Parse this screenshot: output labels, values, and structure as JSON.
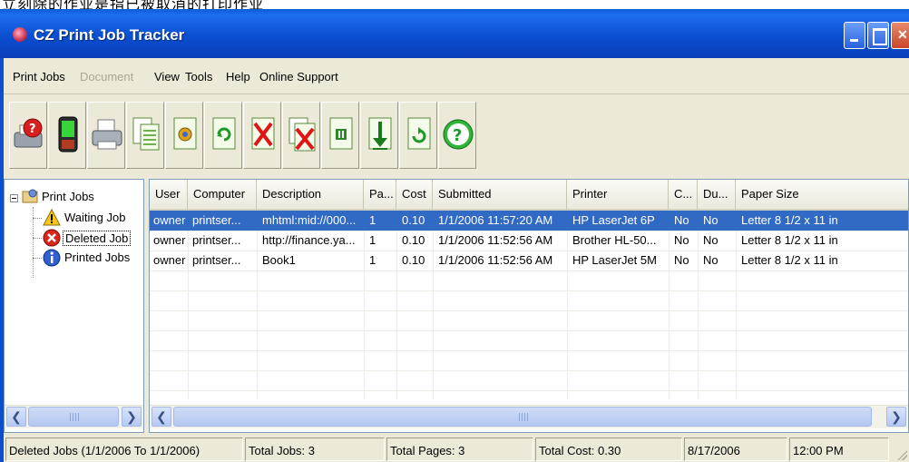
{
  "caption": "立刻除的作业是指已被取消的打印作业",
  "window": {
    "title": "CZ Print Job Tracker"
  },
  "menu": {
    "items": [
      "Print Jobs",
      "Document",
      "View",
      "Tools",
      "Help",
      "Online Support"
    ],
    "disabled": [
      "Document"
    ]
  },
  "toolbar": {
    "buttons": [
      {
        "name": "printer-help-icon"
      },
      {
        "name": "pda-icon"
      },
      {
        "name": "printer-icon"
      },
      {
        "name": "documents-icon"
      },
      {
        "name": "document-settings-icon"
      },
      {
        "name": "refresh-document-icon"
      },
      {
        "name": "delete-icon"
      },
      {
        "name": "delete-document-icon"
      },
      {
        "name": "pause-document-icon"
      },
      {
        "name": "move-down-icon"
      },
      {
        "name": "restart-document-icon"
      },
      {
        "name": "help-icon"
      }
    ]
  },
  "tree": {
    "root": "Print Jobs",
    "children": [
      "Waiting Job",
      "Deleted Job",
      "Printed Jobs"
    ],
    "selected": "Deleted Job"
  },
  "grid": {
    "columns": [
      "User",
      "Computer",
      "Description",
      "Pa...",
      "Cost",
      "Submitted",
      "Printer",
      "C...",
      "Du...",
      "Paper Size"
    ],
    "rows": [
      [
        "owner",
        "printser...",
        "mhtml:mid://000...",
        "1",
        "0.10",
        "1/1/2006 11:57:20 AM",
        "HP LaserJet 6P",
        "No",
        "No",
        "Letter 8 1/2 x 11 in"
      ],
      [
        "owner",
        "printser...",
        "http://finance.ya...",
        "1",
        "0.10",
        "1/1/2006 11:52:56 AM",
        "Brother HL-50...",
        "No",
        "No",
        "Letter 8 1/2 x 11 in"
      ],
      [
        "owner",
        "printser...",
        "Book1",
        "1",
        "0.10",
        "1/1/2006 11:52:56 AM",
        "HP LaserJet 5M",
        "No",
        "No",
        "Letter 8 1/2 x 11 in"
      ]
    ],
    "selected_row": 0
  },
  "status": {
    "filter": "Deleted Jobs (1/1/2006 To 1/1/2006)",
    "total_jobs": "Total Jobs: 3",
    "total_pages": "Total Pages: 3",
    "total_cost": "Total Cost: 0.30",
    "date": "8/17/2006",
    "time": "12:00 PM"
  },
  "colors": {
    "titlebar": "#0b4fd1",
    "selection": "#316ac5",
    "chrome": "#ece9d8"
  }
}
